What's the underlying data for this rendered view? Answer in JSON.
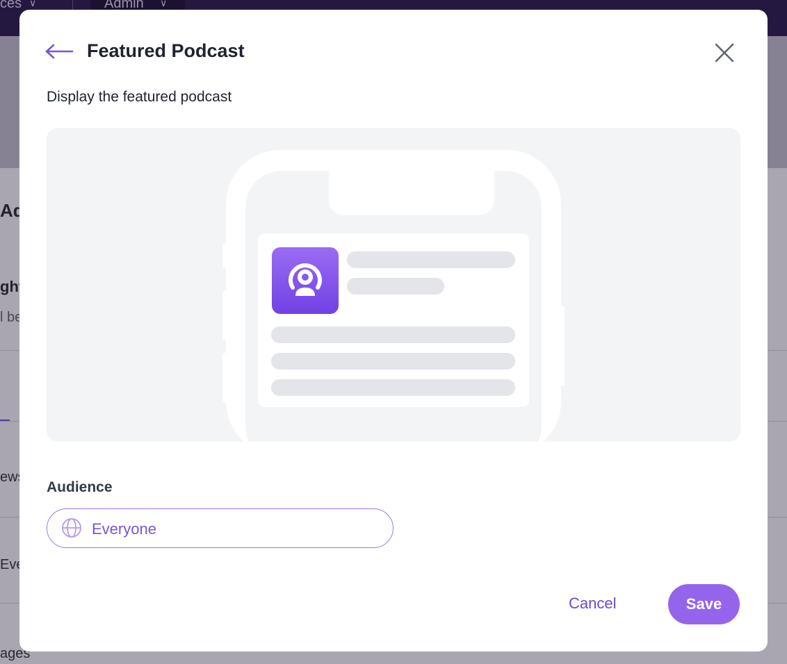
{
  "background": {
    "nav_left_label": "ces",
    "nav_admin_label": "Admin",
    "page_heading_fragment": "Ad",
    "section_heading_fragment": "ght",
    "section_sub_fragment": "l be",
    "list_items": [
      "ews",
      "Eve",
      "ages"
    ]
  },
  "modal": {
    "title": "Featured Podcast",
    "subtitle": "Display the featured podcast",
    "audience": {
      "label": "Audience",
      "value": "Everyone",
      "icon": "globe-icon"
    },
    "actions": {
      "cancel_label": "Cancel",
      "save_label": "Save"
    },
    "preview": {
      "app_icon": "podcast-icon"
    }
  },
  "colors": {
    "accent": "#7b53d9",
    "save_button": "#9564ec",
    "topbar": "#2a1a4a",
    "podcast_icon_gradient": [
      "#9b6cf3",
      "#7141e4"
    ]
  }
}
